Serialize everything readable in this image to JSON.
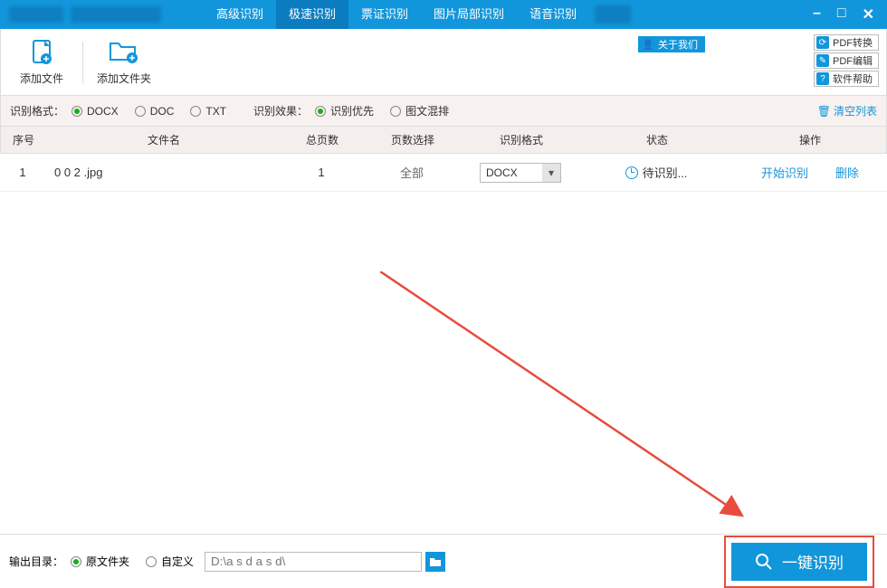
{
  "titlebar": {
    "tabs": [
      "高级识别",
      "极速识别",
      "票证识别",
      "图片局部识别",
      "语音识别"
    ],
    "active_tab": 1
  },
  "toolbar": {
    "add_file": "添加文件",
    "add_folder": "添加文件夹",
    "about": "关于我们",
    "side_links": [
      "PDF转换",
      "PDF编辑",
      "软件帮助"
    ]
  },
  "options": {
    "format_label": "识别格式：",
    "formats": [
      "DOCX",
      "DOC",
      "TXT"
    ],
    "format_selected": 0,
    "effect_label": "识别效果：",
    "effects": [
      "识别优先",
      "图文混排"
    ],
    "effect_selected": 0,
    "clear": "清空列表"
  },
  "table": {
    "headers": {
      "num": "序号",
      "name": "文件名",
      "pages": "总页数",
      "pagesel": "页数选择",
      "format": "识别格式",
      "status": "状态",
      "action": "操作"
    },
    "rows": [
      {
        "num": "1",
        "name": "0 0 2 .jpg",
        "pages": "1",
        "pagesel": "全部",
        "format": "DOCX",
        "status": "待识别...",
        "action_start": "开始识别",
        "action_delete": "删除"
      }
    ]
  },
  "footer": {
    "out_label": "输出目录：",
    "out_options": [
      "原文件夹",
      "自定义"
    ],
    "out_selected": 0,
    "path_placeholder": "D:\\a s d a s d\\",
    "main_button": "一键识别"
  }
}
